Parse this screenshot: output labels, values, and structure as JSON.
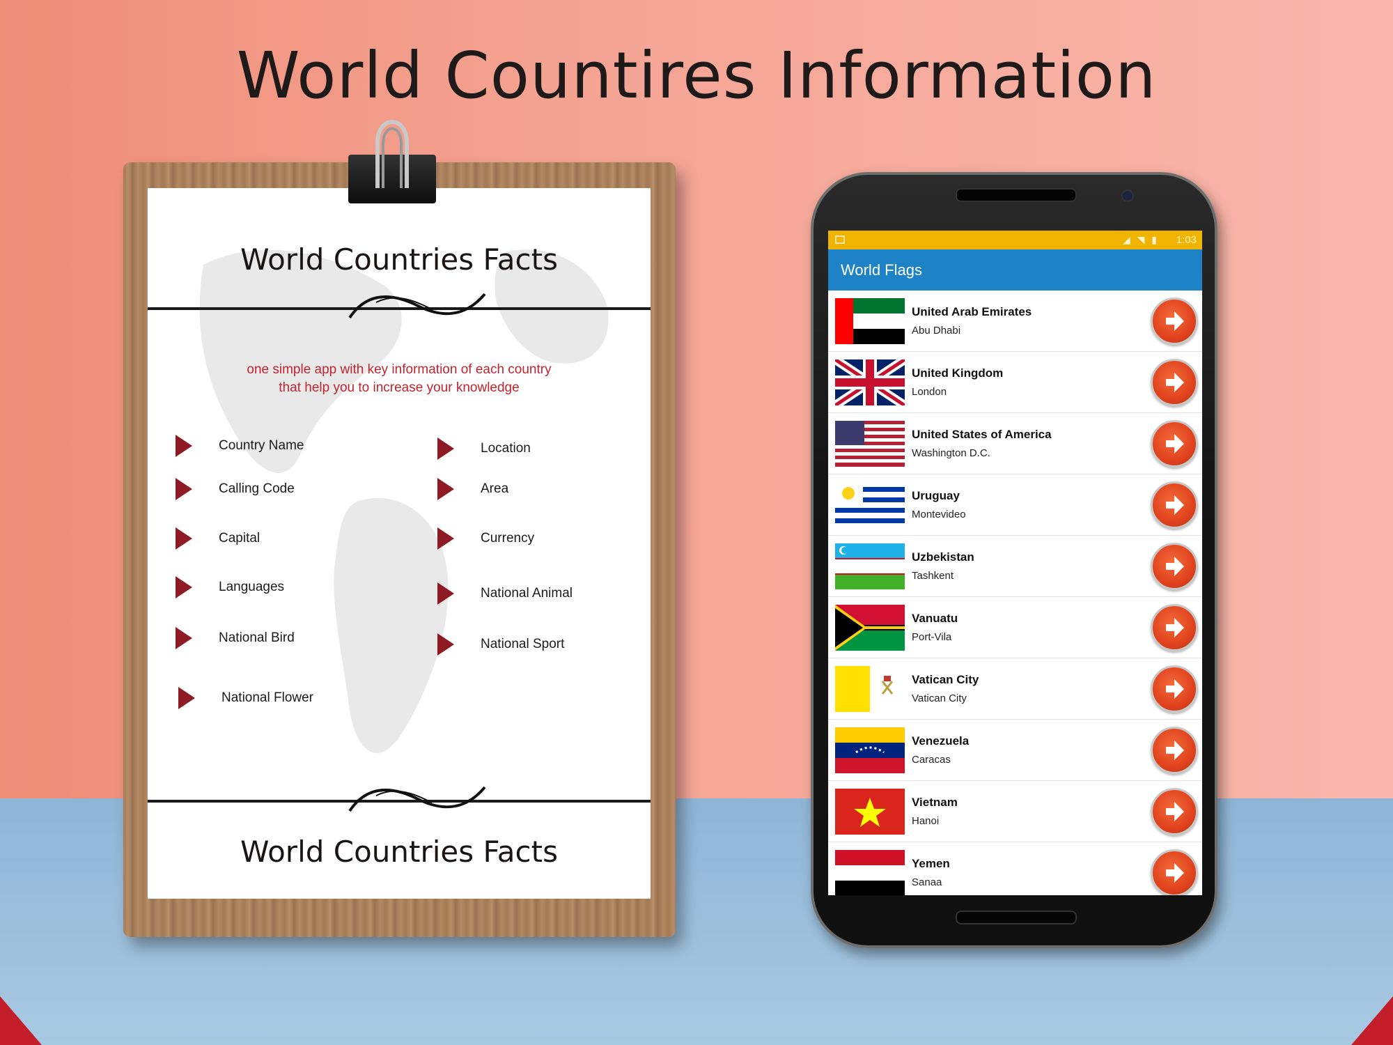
{
  "title": "World Countires Information",
  "clipboard": {
    "top_title": "World Countries Facts",
    "tagline_line1": "one simple app with key information of each country",
    "tagline_line2": "that help you to increase your knowledge",
    "features_left": [
      "Country Name",
      "Calling Code",
      "Capital",
      "Languages",
      "National Bird",
      "National Flower"
    ],
    "features_right": [
      "Location",
      "Area",
      "Currency",
      "National Animal",
      "National Sport"
    ],
    "bottom_title": "World Countries Facts"
  },
  "phone": {
    "status_time": "1:03",
    "app_title": "World Flags",
    "countries": [
      {
        "name": "United Arab Emirates",
        "capital": "Abu Dhabi",
        "flag_icon": "uae-flag-icon"
      },
      {
        "name": "United Kingdom",
        "capital": "London",
        "flag_icon": "uk-flag-icon"
      },
      {
        "name": "United States of America",
        "capital": "Washington D.C.",
        "flag_icon": "usa-flag-icon"
      },
      {
        "name": "Uruguay",
        "capital": "Montevideo",
        "flag_icon": "uruguay-flag-icon"
      },
      {
        "name": "Uzbekistan",
        "capital": "Tashkent",
        "flag_icon": "uzbekistan-flag-icon"
      },
      {
        "name": "Vanuatu",
        "capital": "Port-Vila",
        "flag_icon": "vanuatu-flag-icon"
      },
      {
        "name": "Vatican City",
        "capital": "Vatican City",
        "flag_icon": "vatican-flag-icon"
      },
      {
        "name": "Venezuela",
        "capital": "Caracas",
        "flag_icon": "venezuela-flag-icon"
      },
      {
        "name": "Vietnam",
        "capital": "Hanoi",
        "flag_icon": "vietnam-flag-icon"
      },
      {
        "name": "Yemen",
        "capital": "Sanaa",
        "flag_icon": "yemen-flag-icon"
      }
    ]
  },
  "colors": {
    "statusbar": "#f0b400",
    "appbar": "#1d82c6",
    "go_button": "#e0431d",
    "tagline": "#c2232f",
    "bullet_arrow": "#8e1b24"
  }
}
